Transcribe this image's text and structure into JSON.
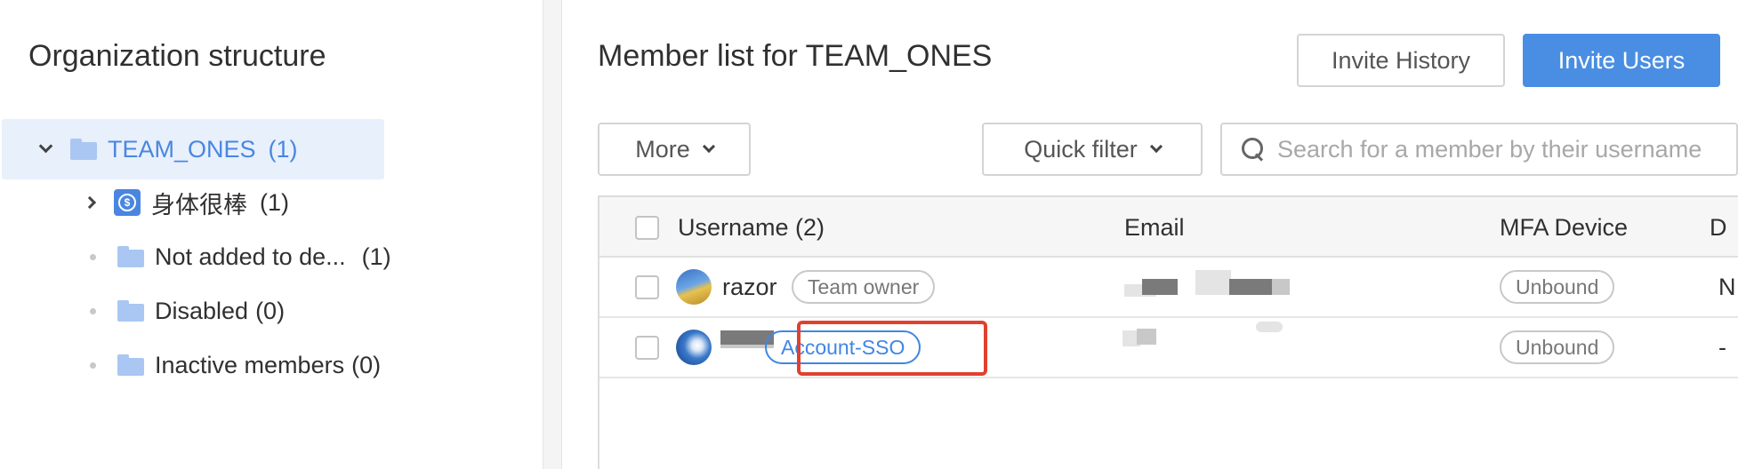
{
  "left": {
    "title": "Organization structure",
    "tree": [
      {
        "label": "TEAM_ONES",
        "count": "(1)",
        "selected": true
      },
      {
        "label": "身体很棒",
        "count": "(1)"
      },
      {
        "label": "Not added to de...",
        "count": "(1)"
      },
      {
        "label": "Disabled",
        "count": "(0)"
      },
      {
        "label": "Inactive members",
        "count": "(0)"
      }
    ]
  },
  "header": {
    "title": "Member list for TEAM_ONES",
    "invite_history": "Invite History",
    "invite_users": "Invite Users"
  },
  "toolbar": {
    "more": "More",
    "quick_filter": "Quick filter",
    "search_placeholder": "Search for a member by their username"
  },
  "table": {
    "columns": [
      "Username (2)",
      "Email",
      "MFA Device",
      "D"
    ],
    "rows": [
      {
        "username": "razor",
        "tag": "Team owner",
        "mfa": "Unbound",
        "last": "N"
      },
      {
        "username": "",
        "tag": "Account-SSO",
        "mfa": "Unbound",
        "last": "-"
      }
    ]
  },
  "colors": {
    "accent": "#4a8ee3",
    "selected_bg": "#e8f0fc",
    "highlight": "#e2402f"
  }
}
